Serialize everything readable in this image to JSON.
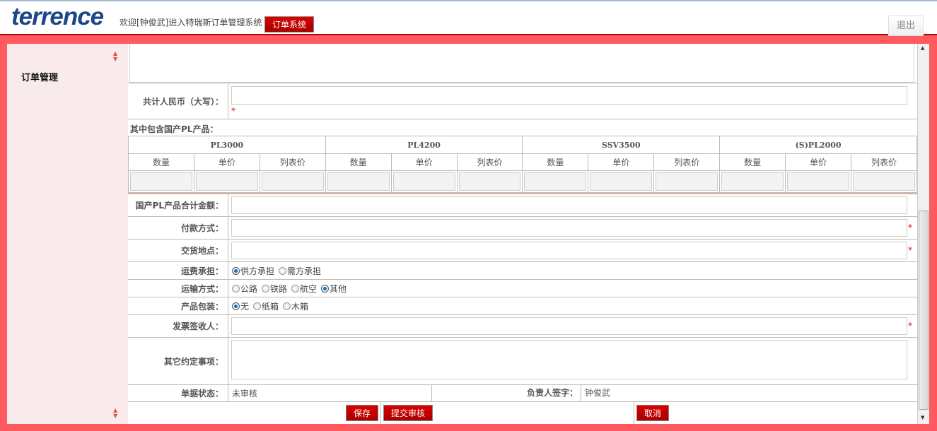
{
  "header": {
    "logo": "terrence",
    "welcome": "欢迎[钟俊武]进入特瑞斯订单管理系统",
    "system_button": "订单系统",
    "exit_button": "退出"
  },
  "sidebar": {
    "title": "订单管理"
  },
  "form": {
    "total_rmb_label": "共计人民币（大写）：",
    "required_mark": "*",
    "included_label": "其中包含国产PL产品：",
    "products": [
      "PL3000",
      "PL4200",
      "SSV3500",
      "(S)PL2000"
    ],
    "subcols": [
      "数量",
      "单价",
      "列表价"
    ],
    "domestic_total_label": "国产PL产品合计金额：",
    "payment_label": "付款方式：",
    "delivery_label": "交货地点：",
    "freight_label": "运费承担：",
    "freight_options": [
      "供方承担",
      "需方承担"
    ],
    "transport_label": "运输方式：",
    "transport_options": [
      "公路",
      "铁路",
      "航空",
      "其他"
    ],
    "packaging_label": "产品包装：",
    "packaging_options": [
      "无",
      "纸箱",
      "木箱"
    ],
    "invoice_label": "发票签收人：",
    "other_label": "其它约定事项：",
    "status_label": "单据状态：",
    "status_value": "未审核",
    "signer_label": "负责人签字：",
    "signer_value": "钟俊武"
  },
  "buttons": {
    "save": "保存",
    "submit": "提交审核",
    "cancel": "取消"
  }
}
